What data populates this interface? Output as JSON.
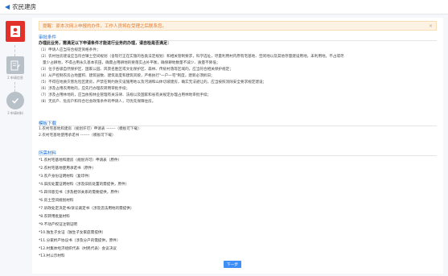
{
  "header": {
    "title": "农民建房"
  },
  "sidebar": {
    "steps": [
      {
        "label": ""
      },
      {
        "label": "2 申请信息"
      },
      {
        "label": "3 申请材料"
      }
    ]
  },
  "notice": {
    "text": "提醒：原本次网上申报的办件，工作人员将在受理之后联系您。"
  },
  "conditions": {
    "title": "审批条件",
    "heading": "办理此业务，需满足以下申请条件才能进行业务的办理，请自检是否满足：",
    "items": [
      "（1）申请人应当符合规定资格条件；",
      "（2）农村住房建设应当符合镇土空间规划（含现行正在实施的各类法定规划）和相关管制要求，科学选址，尽量利用村内原有宅基地、空闲地以及其他存量建设用地，未利用地，不占或尽",
      "量少占耕地，不得占用永久基本农田，确需占用耕地的要落实占补平衡，确保耕地数量不减少、质量不降低；",
      "（3）位于各级自然保护区、国家公园、风景名胜区或文化保护区、森林、传统村落等区域的，应当符合相关保护规定；",
      "（4）从严控制农房占地面积、建筑层数、建筑高度和建筑风貌，严格执行\"一户一宅\"制度，建新必须拆旧；",
      "（5）不得在地质灾害危险区建房，严禁在制约防灾设施用地以及河湖和山体切坡建房，确实无法避让的，应当按照消除安全要求规定建设；",
      "（6）涉及占用农用地的，应先行办理农转用审批手续；",
      "（7）涉及占用林地的，应当依照林业管理有关法律、法规以及国家和省有关规定办理占用林地审批手续；",
      "（8）无房户、危房户和符合社会政策条件的申请人，可优先保障住房。"
    ]
  },
  "downloads": {
    "title": "模板下载",
    "items": [
      "1.农村宅基地和建房（规划许可）申请表 -------（模板可下载）",
      "2.农村宅基地使用承诺书 -------（模板可下载）"
    ]
  },
  "materials": {
    "title": "所需材料",
    "items": [
      "*1.农村宅基地和建房（规划许可）申请表（原件）",
      "*2.农村宅基地使用承诺书（原件）",
      "*3.农户身份证明材料（复印件）",
      "*4.旧房处置证明材料（涉及旧房处置的需提供，原件）",
      "*5.四邻意见书（涉及相邻关系的需要提供，原件）",
      "*6.房土空间规划材料",
      "*7.诉政处定决定书/诉讼裁定书（涉及违法用地的需提供）",
      "*8.农转用批复材料",
      "*9.不动产权证注销证明",
      "*10.独生子女证（独生子女家庭需提供）",
      "*11.分家析产协议书（涉及分户的需提供，原件）",
      "*12.村集体经济组织代表（村民代表）会议决议",
      "*13.村公示材料"
    ]
  },
  "buttons": {
    "next": "下一步"
  }
}
